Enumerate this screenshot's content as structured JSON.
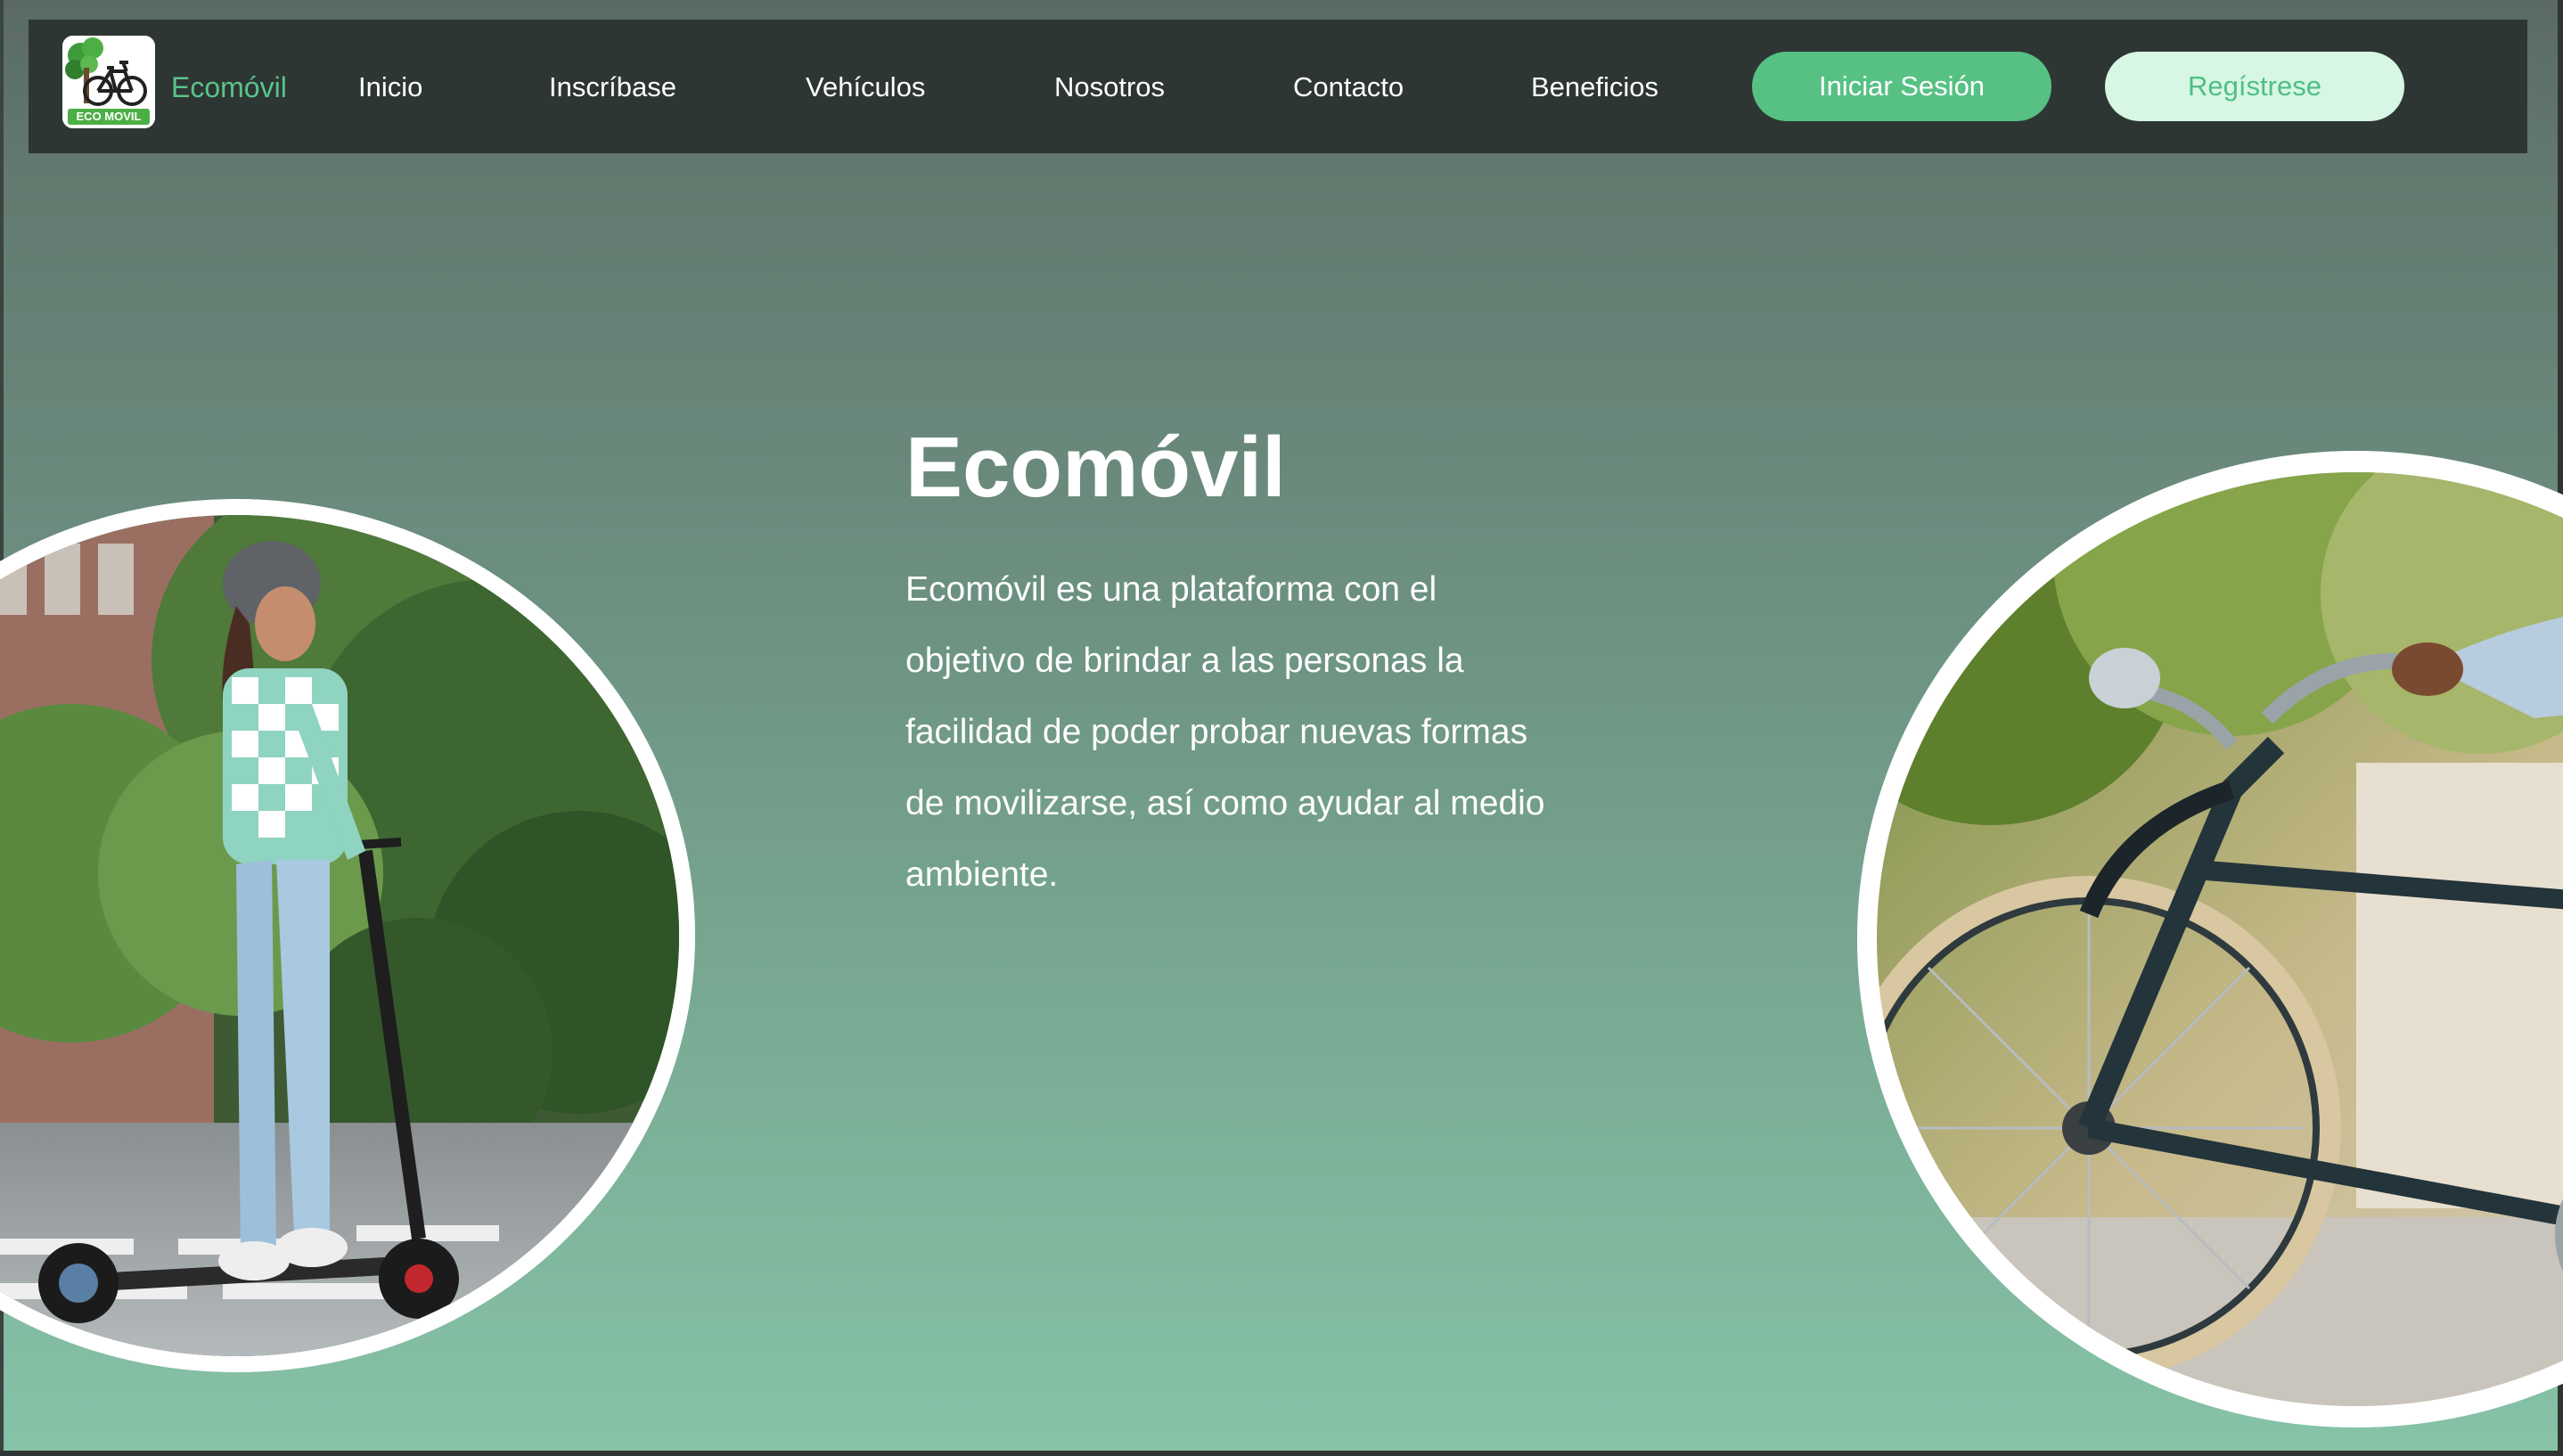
{
  "navbar": {
    "logo_label": "ECO MOVIL",
    "brand": "Ecomóvil",
    "links": [
      "Inicio",
      "Inscríbase",
      "Vehículos",
      "Nosotros",
      "Contacto",
      "Beneficios"
    ],
    "login_label": "Iniciar Sesión",
    "register_label": "Regístrese"
  },
  "hero": {
    "title": "Ecomóvil",
    "description_lines": [
      "Ecomóvil es una plataforma con el",
      "objetivo de brindar a las personas la",
      "facilidad de poder probar nuevas formas",
      "de movilizarse, así como ayudar al medio",
      "ambiente."
    ]
  },
  "colors": {
    "navbar_bg": "#2e3634",
    "brand_green": "#59c48a",
    "login_bg": "#57c184",
    "register_bg": "#d7f7e4",
    "register_text": "#4fbf83"
  },
  "icons": {
    "logo": "bicycle-tree-logo-icon"
  }
}
